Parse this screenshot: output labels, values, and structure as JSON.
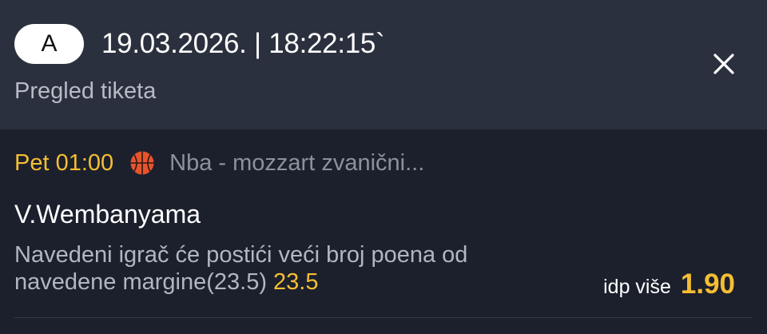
{
  "header": {
    "ticket_letter": "A",
    "datetime": "19.03.2026. | 18:22:15`",
    "subtitle": "Pregled tiketa",
    "close_icon": "close-icon"
  },
  "match": {
    "time": "Pet 01:00",
    "sport_icon": "basketball-icon",
    "league": "Nba - mozzart zvanični...",
    "player": "V.Wembanyama",
    "market_text": "Navedeni igrač će postići veći broj poena od navedene margine(23.5)",
    "margin_value": "23.5",
    "pick_label": "idp više",
    "odds": "1.90"
  },
  "colors": {
    "accent": "#f5be33",
    "header_bg": "#2b303e",
    "body_bg": "#1c202c",
    "basketball": "#e8532e"
  }
}
